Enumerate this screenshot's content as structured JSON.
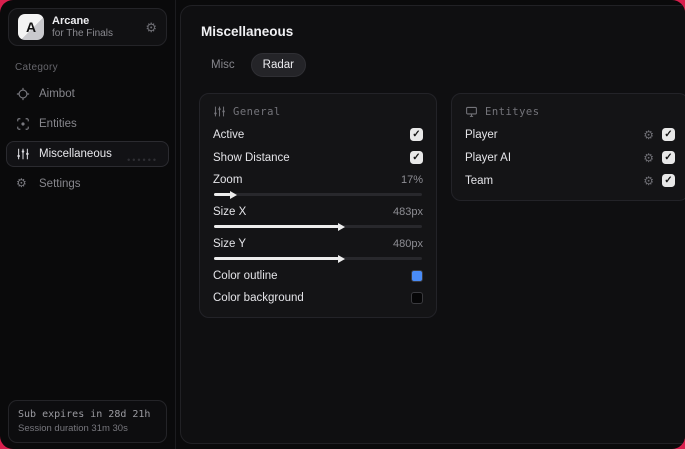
{
  "colors": {
    "background_accent": "#d81f4d",
    "checkbox_fill": "#e8e8e8",
    "slider_fill": "#ededed",
    "outline_swatch": "#4a8cf7",
    "background_swatch": "#060607"
  },
  "sidebar": {
    "app": {
      "initial": "A",
      "title": "Arcane",
      "subtitle": "for The Finals",
      "settings_icon": "gear-icon"
    },
    "category_label": "Category",
    "items": [
      {
        "label": "Aimbot",
        "icon": "crosshair-icon",
        "active": false
      },
      {
        "label": "Entities",
        "icon": "scan-icon",
        "active": false
      },
      {
        "label": "Miscellaneous",
        "icon": "sliders-icon",
        "active": true
      },
      {
        "label": "Settings",
        "icon": "gear-icon",
        "active": false
      }
    ],
    "footer": {
      "line1": "Sub expires in 28d 21h",
      "line2": "Session duration 31m 30s"
    }
  },
  "main": {
    "title": "Miscellaneous",
    "tabs": [
      {
        "label": "Misc",
        "active": false
      },
      {
        "label": "Radar",
        "active": true
      }
    ],
    "panels": [
      {
        "title": "General",
        "icon": "sliders-icon",
        "rows": [
          {
            "type": "toggle",
            "label": "Active",
            "checked": true
          },
          {
            "type": "toggle",
            "label": "Show Distance",
            "checked": true
          },
          {
            "type": "slider",
            "label": "Zoom",
            "value": "17%",
            "percent": 8
          },
          {
            "type": "slider",
            "label": "Size X",
            "value": "483px",
            "percent": 60
          },
          {
            "type": "slider",
            "label": "Size Y",
            "value": "480px",
            "percent": 60
          },
          {
            "type": "color",
            "label": "Color outline",
            "swatch": "#4a8cf7"
          },
          {
            "type": "color",
            "label": "Color background",
            "swatch": "#060607"
          }
        ]
      },
      {
        "title": "Entityes",
        "icon": "monitor-icon",
        "rows": [
          {
            "type": "entity",
            "label": "Player",
            "checked": true,
            "config_icon": "gear-icon"
          },
          {
            "type": "entity",
            "label": "Player AI",
            "checked": true,
            "config_icon": "gear-icon"
          },
          {
            "type": "entity",
            "label": "Team",
            "checked": true,
            "config_icon": "gear-icon"
          }
        ]
      }
    ]
  }
}
